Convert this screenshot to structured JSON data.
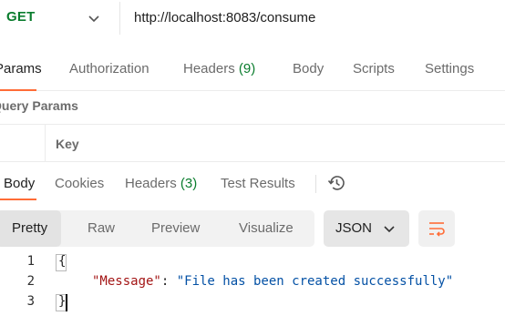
{
  "request": {
    "method": "GET",
    "url": "http://localhost:8083/consume"
  },
  "request_tabs": [
    {
      "label": "Params",
      "active": true
    },
    {
      "label": "Authorization"
    },
    {
      "label": "Headers ",
      "count": "(9)"
    },
    {
      "label": "Body"
    },
    {
      "label": "Scripts"
    },
    {
      "label": "Settings"
    }
  ],
  "query_params": {
    "title": "Query Params",
    "key_header": "Key"
  },
  "response_tabs": [
    {
      "label": "Body",
      "active": true
    },
    {
      "label": "Cookies"
    },
    {
      "label": "Headers ",
      "count": "(3)"
    },
    {
      "label": "Test Results"
    }
  ],
  "view_modes": [
    "Pretty",
    "Raw",
    "Preview",
    "Visualize"
  ],
  "format": "JSON",
  "code": {
    "line_numbers": [
      "1",
      "2",
      "3"
    ],
    "open_brace": "{",
    "key": "\"Message\"",
    "colon": ": ",
    "value": "\"File has been created successfully\"",
    "close_brace": "}"
  },
  "colors": {
    "accent": "#ff6c37",
    "method_green": "#0b7d2e",
    "json_key": "#a31515",
    "json_string": "#0451a5"
  },
  "icons": [
    "chevron-down-icon",
    "history-icon",
    "wrap-lines-icon"
  ]
}
